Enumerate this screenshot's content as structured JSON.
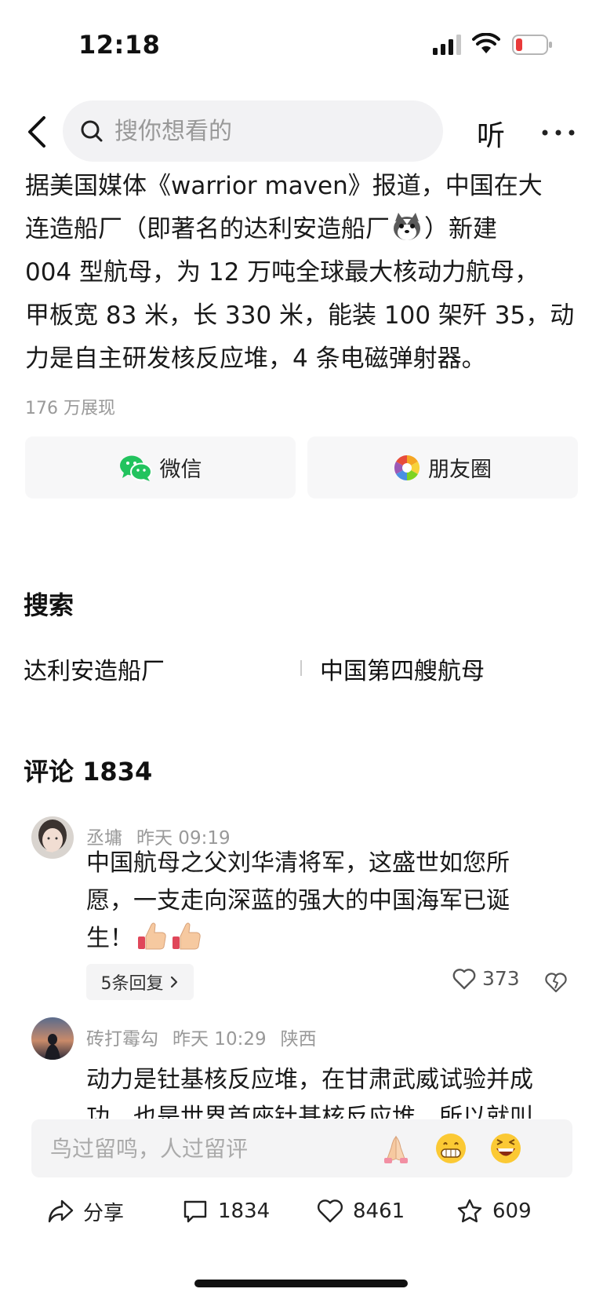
{
  "status": {
    "time": "12:18"
  },
  "nav": {
    "search_placeholder": "搜你想看的",
    "listen_label": "听"
  },
  "article": {
    "line1": "据美国媒体《warrior maven》报道，中国在大",
    "line2a": "连造船厂（即著名的达利安造船厂",
    "line2b": "）新建",
    "line3": "004 型航母，为 12 万吨全球最大核动力航母，",
    "line4": "甲板宽 83 米，长 330 米，能装 100 架歼 35，动",
    "line5": "力是自主研发核反应堆，4 条电磁弹射器。",
    "views": "176 万展现"
  },
  "share": {
    "wechat_label": "微信",
    "moments_label": "朋友圈"
  },
  "search_section": {
    "title": "搜索",
    "links": [
      "达利安造船厂",
      "中国第四艘航母"
    ]
  },
  "comments_section": {
    "title": "评论 1834",
    "comments": [
      {
        "user": "丞墉",
        "time": "昨天 09:19",
        "location": "",
        "line1": "中国航母之父刘华清将军，这盛世如您所",
        "line2": "愿，一支走向深蓝的强大的中国海军已诞",
        "line3": "生！",
        "replies_label": "5条回复",
        "likes": "373"
      },
      {
        "user": "砖打霉勾",
        "time": "昨天 10:29",
        "location": "陕西",
        "line1": "动力是钍基核反应堆，在甘肃武威试验并成",
        "line2": "功，也是世界首座钍基核反应堆，所以就叫"
      }
    ]
  },
  "input_bar": {
    "placeholder": "鸟过留鸣，人过留评"
  },
  "actions": {
    "share_label": "分享",
    "comments_count": "1834",
    "likes_count": "8461",
    "favorites_count": "609"
  },
  "colors": {
    "accent_red": "#e93a3a",
    "wechat_green": "#22c35e",
    "text_gray": "#999999"
  }
}
